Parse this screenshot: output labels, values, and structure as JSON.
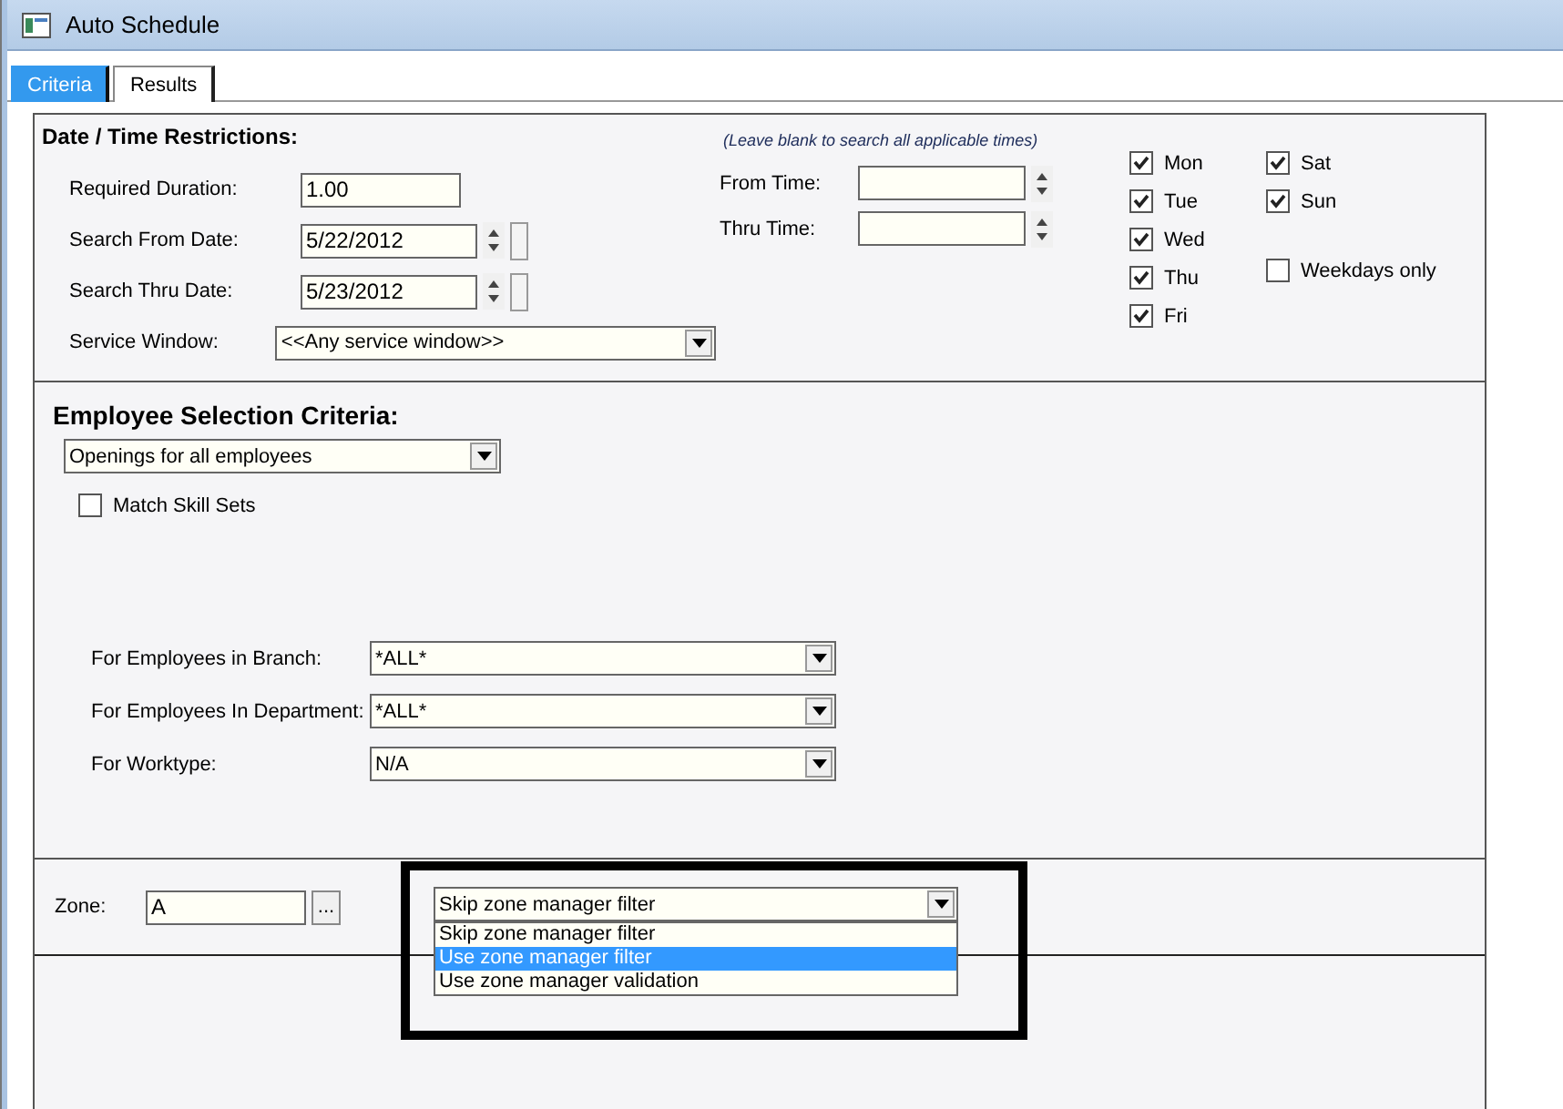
{
  "window": {
    "title": "Auto Schedule"
  },
  "tabs": [
    {
      "label": "Criteria",
      "selected": true
    },
    {
      "label": "Results",
      "selected": false
    }
  ],
  "date_time": {
    "heading": "Date / Time Restrictions:",
    "note": "(Leave blank to search all applicable times)",
    "fields": [
      {
        "label": "Required Duration:",
        "value": "1.00",
        "kind": "text"
      },
      {
        "label": "Search From Date:",
        "value": "5/22/2012",
        "kind": "date"
      },
      {
        "label": "Search Thru Date:",
        "value": "5/23/2012",
        "kind": "date"
      },
      {
        "label": "Service Window:",
        "value": "<<Any service window>>",
        "kind": "combo"
      }
    ],
    "time_fields": [
      {
        "label": "From Time:"
      },
      {
        "label": "Thru Time:"
      }
    ],
    "days": [
      {
        "label": "Mon",
        "checked": true
      },
      {
        "label": "Tue",
        "checked": true
      },
      {
        "label": "Wed",
        "checked": true
      },
      {
        "label": "Thu",
        "checked": true
      },
      {
        "label": "Fri",
        "checked": true
      },
      {
        "label": "Sat",
        "checked": true
      },
      {
        "label": "Sun",
        "checked": true
      }
    ],
    "weekdays_only": {
      "label": "Weekdays only",
      "checked": false
    }
  },
  "employee": {
    "heading": "Employee Selection Criteria:",
    "selection": "Openings for all employees",
    "match_skill_sets": {
      "label": "Match Skill Sets",
      "checked": false
    },
    "filters": [
      {
        "label": "For Employees in Branch:",
        "value": "*ALL*"
      },
      {
        "label": "For Employees In Department:",
        "value": "*ALL*"
      },
      {
        "label": "For Worktype:",
        "value": "N/A"
      }
    ]
  },
  "zone": {
    "label": "Zone:",
    "value": "A",
    "browse_button": "...",
    "manager_filter": {
      "value": "Skip zone manager filter",
      "expanded": true,
      "options": [
        {
          "label": "Skip zone manager filter",
          "highlighted": false
        },
        {
          "label": "Use zone manager filter",
          "highlighted": true
        },
        {
          "label": "Use zone manager validation",
          "highlighted": false
        }
      ]
    }
  }
}
